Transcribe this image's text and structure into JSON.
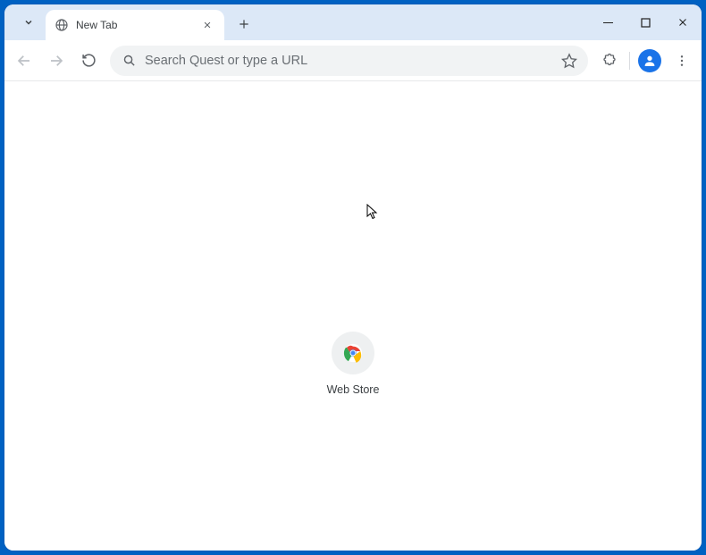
{
  "tab": {
    "title": "New Tab"
  },
  "omnibox": {
    "placeholder": "Search Quest or type a URL",
    "value": ""
  },
  "shortcut": {
    "label": "Web Store"
  }
}
